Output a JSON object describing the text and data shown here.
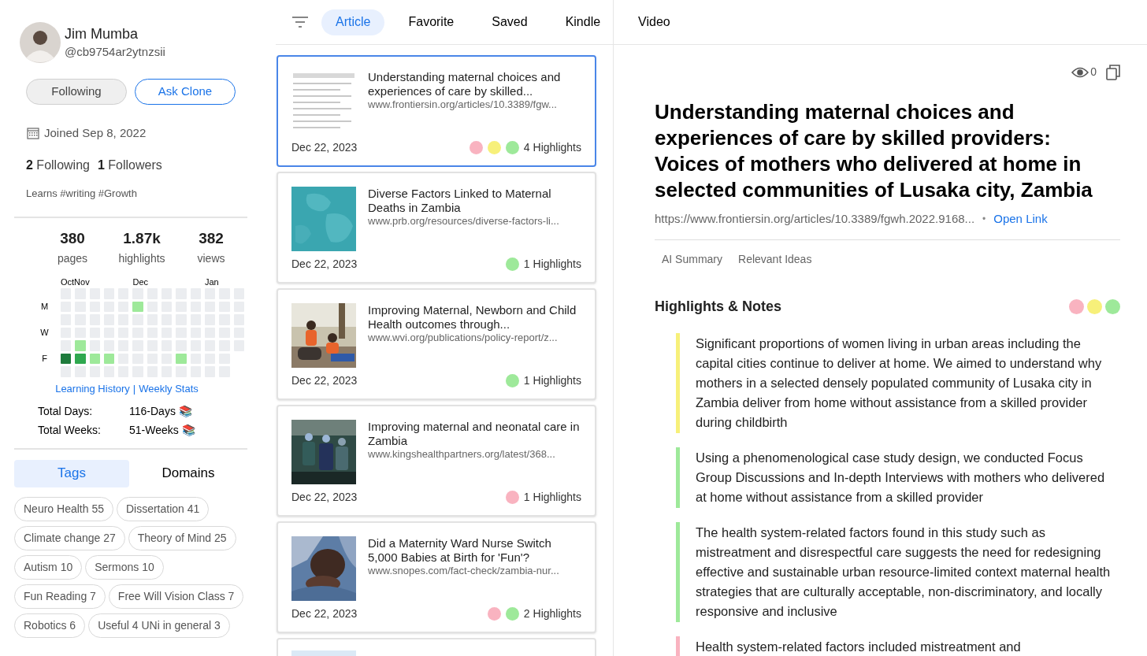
{
  "profile": {
    "name": "Jim Mumba",
    "handle": "@cb9754ar2ytnzsii",
    "buttons": [
      {
        "label": "Following",
        "kind": "secondary"
      },
      {
        "label": "Ask Clone",
        "kind": "primary"
      }
    ],
    "joined": "Joined Sep 8, 2022",
    "following_count": "2",
    "following_label": "Following",
    "followers_count": "1",
    "followers_label": "Followers",
    "bio": "Learns #writing #Growth"
  },
  "stats": [
    {
      "value": "380",
      "label": "pages"
    },
    {
      "value": "1.87k",
      "label": "highlights"
    },
    {
      "value": "382",
      "label": "views"
    }
  ],
  "heatmap": {
    "months": [
      "OctNov",
      "Dec",
      "Jan"
    ],
    "rows": [
      {
        "label": "",
        "cells": [
          {
            "kind": "none"
          },
          {
            "kind": "none"
          },
          {
            "kind": "none"
          },
          {
            "kind": "none"
          },
          {
            "kind": "none"
          },
          {
            "kind": "none"
          },
          {
            "kind": "none"
          },
          {
            "kind": "none"
          },
          {
            "kind": "none"
          },
          {
            "kind": "none"
          },
          {
            "kind": "none"
          },
          {
            "kind": "none"
          },
          {
            "kind": "none"
          }
        ]
      },
      {
        "label": "M",
        "cells": [
          {
            "kind": "none"
          },
          {
            "kind": "none"
          },
          {
            "kind": "none"
          },
          {
            "kind": "none"
          },
          {
            "kind": "none"
          },
          {
            "kind": "low"
          },
          {
            "kind": "none"
          },
          {
            "kind": "none"
          },
          {
            "kind": "none"
          },
          {
            "kind": "none"
          },
          {
            "kind": "none"
          },
          {
            "kind": "none"
          },
          {
            "kind": "none"
          }
        ]
      },
      {
        "label": "",
        "cells": [
          {
            "kind": "none"
          },
          {
            "kind": "none"
          },
          {
            "kind": "none"
          },
          {
            "kind": "none"
          },
          {
            "kind": "none"
          },
          {
            "kind": "none"
          },
          {
            "kind": "none"
          },
          {
            "kind": "none"
          },
          {
            "kind": "none"
          },
          {
            "kind": "none"
          },
          {
            "kind": "none"
          },
          {
            "kind": "none"
          },
          {
            "kind": "none"
          }
        ]
      },
      {
        "label": "W",
        "cells": [
          {
            "kind": "none"
          },
          {
            "kind": "none"
          },
          {
            "kind": "none"
          },
          {
            "kind": "none"
          },
          {
            "kind": "none"
          },
          {
            "kind": "none"
          },
          {
            "kind": "none"
          },
          {
            "kind": "none"
          },
          {
            "kind": "none"
          },
          {
            "kind": "none"
          },
          {
            "kind": "none"
          },
          {
            "kind": "none"
          },
          {
            "kind": "none"
          }
        ]
      },
      {
        "label": "",
        "cells": [
          {
            "kind": "none"
          },
          {
            "kind": "low"
          },
          {
            "kind": "none"
          },
          {
            "kind": "none"
          },
          {
            "kind": "none"
          },
          {
            "kind": "none"
          },
          {
            "kind": "none"
          },
          {
            "kind": "none"
          },
          {
            "kind": "none"
          },
          {
            "kind": "none"
          },
          {
            "kind": "none"
          },
          {
            "kind": "none"
          },
          {
            "kind": "none"
          }
        ]
      },
      {
        "label": "F",
        "cells": [
          {
            "kind": "high"
          },
          {
            "kind": "medium"
          },
          {
            "kind": "low"
          },
          {
            "kind": "low"
          },
          {
            "kind": "none"
          },
          {
            "kind": "none"
          },
          {
            "kind": "none"
          },
          {
            "kind": "none"
          },
          {
            "kind": "low"
          },
          {
            "kind": "none"
          },
          {
            "kind": "none"
          },
          {
            "kind": "none"
          }
        ]
      },
      {
        "label": "",
        "cells": [
          {
            "kind": "none"
          },
          {
            "kind": "none"
          },
          {
            "kind": "none"
          },
          {
            "kind": "none"
          },
          {
            "kind": "none"
          },
          {
            "kind": "none"
          },
          {
            "kind": "none"
          },
          {
            "kind": "none"
          },
          {
            "kind": "none"
          },
          {
            "kind": "none"
          },
          {
            "kind": "none"
          },
          {
            "kind": "none"
          }
        ]
      }
    ]
  },
  "history_links": [
    "Learning History",
    "|",
    "Weekly Stats"
  ],
  "totals": [
    {
      "label": "Total Days:",
      "value": "116-Days 📚"
    },
    {
      "label": "Total Weeks:",
      "value": "51-Weeks 📚"
    }
  ],
  "sidebar_tabs": [
    {
      "label": "Tags",
      "selected": true
    },
    {
      "label": "Domains",
      "selected": false
    }
  ],
  "tags": [
    "Neuro Health 55",
    "Dissertation 41",
    "Climate change 27",
    "Theory of Mind 25",
    "Autism 10",
    "Sermons 10",
    "Fun Reading 7",
    "Free Will Vision Class 7",
    "Robotics 6",
    "Useful 4 UNi in general 3"
  ],
  "nav_tabs": [
    {
      "label": "Article",
      "selected": true
    },
    {
      "label": "Favorite",
      "selected": false
    },
    {
      "label": "Saved",
      "selected": false
    },
    {
      "label": "Kindle",
      "selected": false
    },
    {
      "label": "Video",
      "selected": false
    }
  ],
  "articles": [
    {
      "title": "Understanding maternal choices and experiences of care by skilled...",
      "url": "www.frontiersin.org/articles/10.3389/fgw...",
      "date": "Dec 22, 2023",
      "highlights": "4 Highlights",
      "selected": true,
      "dots": [
        {
          "color": "#f9b3c0"
        },
        {
          "color": "#f7f07a"
        },
        {
          "color": "#9ee99a"
        }
      ]
    },
    {
      "title": "Diverse Factors Linked to Maternal Deaths in Zambia",
      "url": "www.prb.org/resources/diverse-factors-li...",
      "date": "Dec 22, 2023",
      "highlights": "1 Highlights",
      "selected": false,
      "dots": [
        {
          "color": "#9ee99a"
        }
      ]
    },
    {
      "title": "Improving Maternal, Newborn and Child Health outcomes through...",
      "url": "www.wvi.org/publications/policy-report/z...",
      "date": "Dec 22, 2023",
      "highlights": "1 Highlights",
      "selected": false,
      "dots": [
        {
          "color": "#9ee99a"
        }
      ]
    },
    {
      "title": "Improving maternal and neonatal care in Zambia",
      "url": "www.kingshealthpartners.org/latest/368...",
      "date": "Dec 22, 2023",
      "highlights": "1 Highlights",
      "selected": false,
      "dots": [
        {
          "color": "#f9b3c0"
        }
      ]
    },
    {
      "title": "Did a Maternity Ward Nurse Switch 5,000 Babies at Birth for 'Fun'?",
      "url": "www.snopes.com/fact-check/zambia-nur...",
      "date": "Dec 22, 2023",
      "highlights": "2 Highlights",
      "selected": false,
      "dots": [
        {
          "color": "#f9b3c0"
        },
        {
          "color": "#9ee99a"
        }
      ]
    }
  ],
  "detail": {
    "views": "0",
    "title": "Understanding maternal choices and experiences of care by skilled providers: Voices of mothers who delivered at home in selected communities of Lusaka city, Zambia",
    "url": "https://www.frontiersin.org/articles/10.3389/fgwh.2022.9168...",
    "separator": "•",
    "open_link": "Open Link",
    "tabs": [
      "AI Summary",
      "Relevant Ideas"
    ],
    "notes_heading": "Highlights & Notes",
    "filters": [
      {
        "color": "#f9b3c0"
      },
      {
        "color": "#f7f07a"
      },
      {
        "color": "#9ee99a"
      }
    ],
    "notes": [
      {
        "color": "#f7f07a",
        "text": "Significant proportions of women living in urban areas including the capital cities continue to deliver at home. We aimed to understand why mothers in a selected densely populated community of Lusaka city in Zambia deliver from home without assistance from a skilled provider during childbirth"
      },
      {
        "color": "#9ee99a",
        "text": "Using a phenomenological case study design, we conducted Focus Group Discussions and In-depth Interviews with mothers who delivered at home without assistance from a skilled provider"
      },
      {
        "color": "#9ee99a",
        "text": "The health system-related factors found in this study such as mistreatment and disrespectful care suggests the need for redesigning effective and sustainable urban resource-limited context maternal health strategies that are culturally acceptable, non-discriminatory, and locally responsive and inclusive"
      },
      {
        "color": "#f9b3c0",
        "text": "Health system-related factors included mistreatment and"
      }
    ]
  }
}
